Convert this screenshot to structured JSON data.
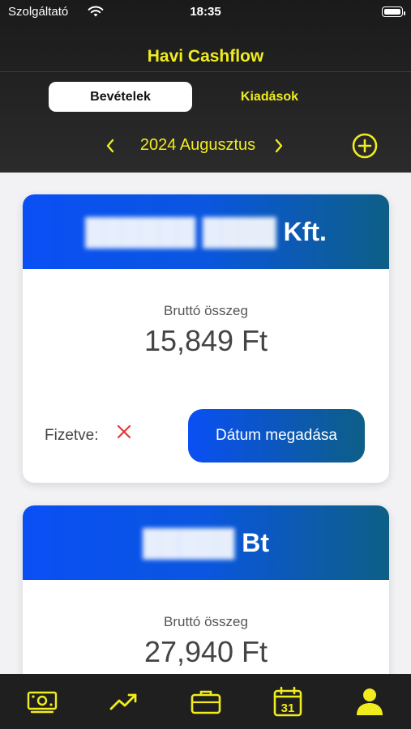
{
  "status_bar": {
    "carrier": "Szolgáltató",
    "time": "18:35"
  },
  "header": {
    "title": "Havi Cashflow",
    "tabs": [
      {
        "label": "Bevételek",
        "active": true
      },
      {
        "label": "Kiadások",
        "active": false
      }
    ],
    "month": "2024 Augusztus",
    "prev_icon": "chevron-left-icon",
    "next_icon": "chevron-right-icon",
    "add_icon": "plus-circle-icon"
  },
  "cards": [
    {
      "name_blurred": "██████ ████",
      "name_suffix": "Kft.",
      "gross_label": "Bruttó összeg",
      "gross_value": "15,849 Ft",
      "paid_label": "Fizetve:",
      "paid_status": "not-paid",
      "date_button_label": "Dátum megadása"
    },
    {
      "name_blurred": "█████",
      "name_suffix": "Bt",
      "gross_label": "Bruttó összeg",
      "gross_value": "27,940 Ft"
    }
  ],
  "tabbar": {
    "items": [
      {
        "icon": "money-icon"
      },
      {
        "icon": "trend-up-icon"
      },
      {
        "icon": "briefcase-icon"
      },
      {
        "icon": "calendar-icon",
        "calendar_day": "31"
      },
      {
        "icon": "person-icon"
      }
    ]
  },
  "colors": {
    "accent": "#f0ec1e",
    "banner_start": "#0a4ff5",
    "banner_end": "#0d5f86",
    "header_bg": "#222222",
    "error_red": "#e53935"
  }
}
